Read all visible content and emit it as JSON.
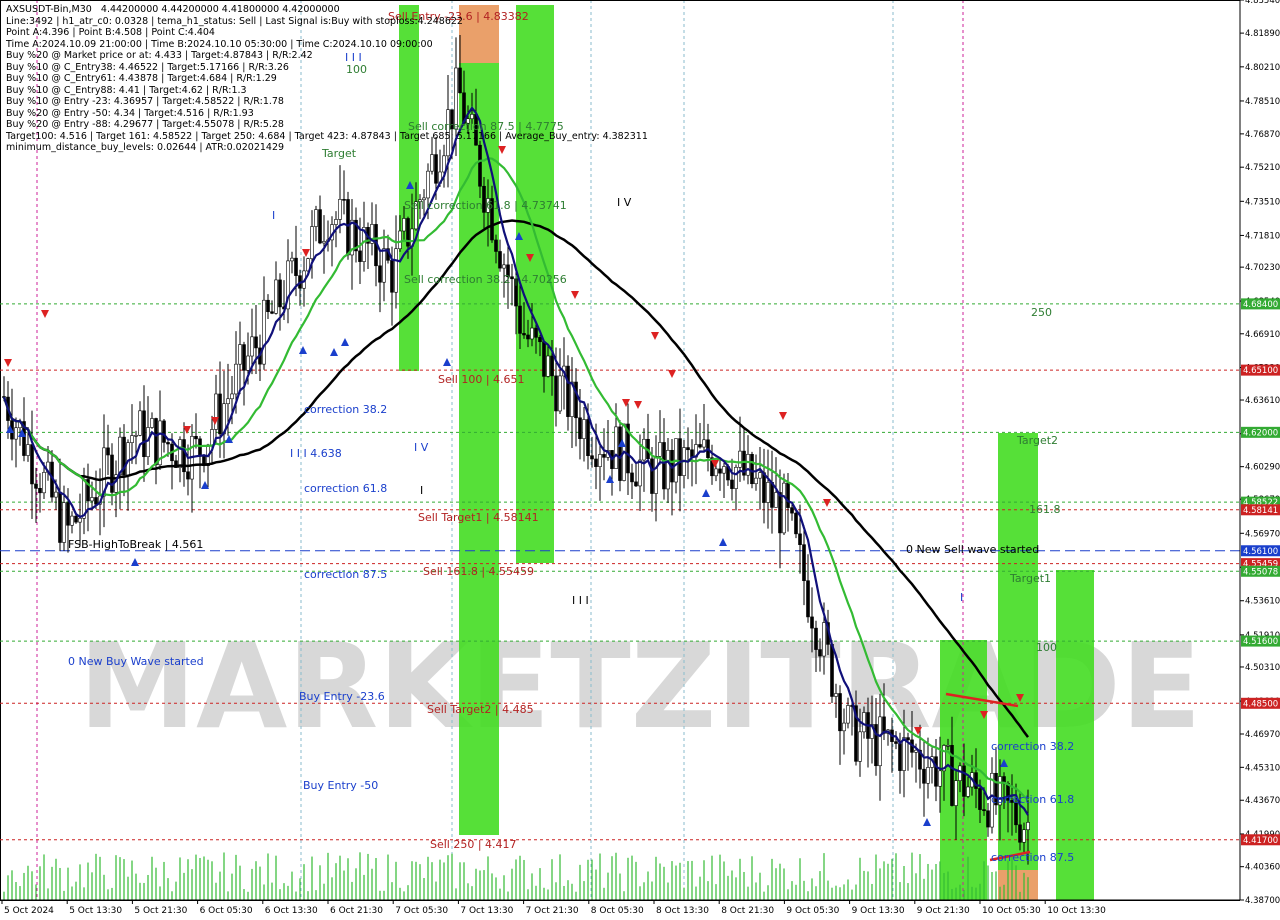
{
  "info_lines": [
    "AXSUSDT-Bin,M30   4.44200000 4.44200000 4.41800000 4.42000000",
    "Line:3492 | h1_atr_c0: 0.0328 | tema_h1_status: Sell | Last Signal is:Buy with stoploss:4.248622",
    "Point A:4.396 | Point B:4.508 | Point C:4.404",
    "Time A:2024.10.09 21:00:00 | Time B:2024.10.10 05:30:00 | Time C:2024.10.10 09:00:00",
    "Buy %20 @ Market price or at: 4.433 | Target:4.87843 | R/R:2.42",
    "Buy %10 @ C_Entry38: 4.46522 | Target:5.17166 | R/R:3.26",
    "Buy %10 @ C_Entry61: 4.43878 | Target:4.684 | R/R:1.29",
    "Buy %10 @ C_Entry88: 4.41 | Target:4.62 | R/R:1.3",
    "Buy %10 @ Entry -23: 4.36957 | Target:4.58522 | R/R:1.78",
    "Buy %20 @ Entry -50: 4.34 | Target:4.516 | R/R:1.93",
    "Buy %20 @ Entry -88: 4.29677 | Target:4.55078 | R/R:5.28",
    "Target100: 4.516 | Target 161: 4.58522 | Target 250: 4.684 | Target 423: 4.87843 | Target 685: 5.17166 | Average_Buy_entry: 4.382311",
    "minimum_distance_buy_levels: 0.02644 | ATR:0.02021429"
  ],
  "watermark": "MARKETZITRADE",
  "price_axis": {
    "ticks": [
      "4.83540",
      "4.81890",
      "4.80210",
      "4.78510",
      "4.76870",
      "4.75210",
      "4.73510",
      "4.71810",
      "4.70230",
      "4.68540",
      "4.66910",
      "4.65230",
      "4.63610",
      "4.61930",
      "4.60290",
      "4.58670",
      "4.56970",
      "4.55280",
      "4.53610",
      "4.51910",
      "4.50310",
      "4.48610",
      "4.46970",
      "4.45310",
      "4.43670",
      "4.41990",
      "4.40360",
      "4.38700"
    ],
    "highlights": [
      {
        "value": "4.68400",
        "color": "#33aa33"
      },
      {
        "value": "4.65100",
        "color": "#cc2222"
      },
      {
        "value": "4.62000",
        "color": "#33aa33"
      },
      {
        "value": "4.58522",
        "color": "#33aa33"
      },
      {
        "value": "4.58141",
        "color": "#cc2222"
      },
      {
        "value": "4.56100",
        "color": "#1a3fcc"
      },
      {
        "value": "4.55459",
        "color": "#cc2222"
      },
      {
        "value": "4.55078",
        "color": "#33aa33"
      },
      {
        "value": "4.51600",
        "color": "#33aa33"
      },
      {
        "value": "4.48500",
        "color": "#cc2222"
      },
      {
        "value": "4.41700",
        "color": "#cc2222"
      }
    ]
  },
  "time_axis": [
    "5 Oct 2024",
    "5 Oct 13:30",
    "5 Oct 21:30",
    "6 Oct 05:30",
    "6 Oct 13:30",
    "6 Oct 21:30",
    "7 Oct 05:30",
    "7 Oct 13:30",
    "7 Oct 21:30",
    "8 Oct 05:30",
    "8 Oct 13:30",
    "8 Oct 21:30",
    "9 Oct 05:30",
    "9 Oct 13:30",
    "9 Oct 21:30",
    "10 Oct 05:30",
    "10 Oct 13:30"
  ],
  "annotations": [
    {
      "text": "Sell Entry -23.6 | 4.83382",
      "color": "#b22222"
    },
    {
      "text": "100",
      "color": "#2e7d32"
    },
    {
      "text": "Target",
      "color": "#2e7d32"
    },
    {
      "text": "Sell correction 87.5 | 4.7775",
      "color": "#2e7d32"
    },
    {
      "text": "Sell correction 61.8 | 4.73741",
      "color": "#2e7d32"
    },
    {
      "text": "Sell correction 38.2 | 4.70256",
      "color": "#2e7d32"
    },
    {
      "text": "I V",
      "color": "#000000"
    },
    {
      "text": "I",
      "color": "#1a3fcc"
    },
    {
      "text": "I I I",
      "color": "#1a3fcc"
    },
    {
      "text": "250",
      "color": "#2e7d32"
    },
    {
      "text": "Sell 100 | 4.651",
      "color": "#b22222"
    },
    {
      "text": "correction 38.2",
      "color": "#1a3fcc"
    },
    {
      "text": "I I I 4.638",
      "color": "#1a3fcc"
    },
    {
      "text": "I V",
      "color": "#1a3fcc"
    },
    {
      "text": "Target2",
      "color": "#2e7d32"
    },
    {
      "text": "correction 61.8",
      "color": "#1a3fcc"
    },
    {
      "text": "I",
      "color": "#000000"
    },
    {
      "text": "Sell Target1 | 4.58141",
      "color": "#b22222"
    },
    {
      "text": "161.8",
      "color": "#2e7d32"
    },
    {
      "text": "FSB-HighToBreak | 4.561",
      "color": "#000000"
    },
    {
      "text": "0 New Sell wave started",
      "color": "#000000"
    },
    {
      "text": "Sell 161.8 | 4.55459",
      "color": "#b22222"
    },
    {
      "text": "correction 87.5",
      "color": "#1a3fcc"
    },
    {
      "text": "Target1",
      "color": "#2e7d32"
    },
    {
      "text": "I I I",
      "color": "#000000"
    },
    {
      "text": "I",
      "color": "#1a3fcc"
    },
    {
      "text": "100",
      "color": "#2e7d32"
    },
    {
      "text": "0 New Buy Wave started",
      "color": "#1a3fcc"
    },
    {
      "text": "Buy Entry -23.6",
      "color": "#1a3fcc"
    },
    {
      "text": "Sell Target2 | 4.485",
      "color": "#b22222"
    },
    {
      "text": "correction 38.2",
      "color": "#1a3fcc"
    },
    {
      "text": "Buy Entry -50",
      "color": "#1a3fcc"
    },
    {
      "text": "correction 61.8",
      "color": "#1a3fcc"
    },
    {
      "text": "Sell  250 | 4.417",
      "color": "#b22222"
    },
    {
      "text": "correction 87.5",
      "color": "#1a3fcc"
    }
  ],
  "colors": {
    "zone_green": "#44dd22",
    "zone_orange": "#e8965a",
    "ema_black": "#000000",
    "ema_green": "#33bb33",
    "ema_navy": "#10107a",
    "sell_red": "#dd2222",
    "buy_blue": "#1a3fcc",
    "candle": "#000000"
  },
  "chart_data": {
    "type": "candlestick",
    "symbol": "AXSUSDT-Bin",
    "timeframe": "M30",
    "ylim": [
      4.387,
      4.8354
    ],
    "key_levels": [
      4.684,
      4.651,
      4.62,
      4.58522,
      4.58141,
      4.561,
      4.55459,
      4.55078,
      4.516,
      4.485,
      4.417
    ],
    "close_path": [
      {
        "t": "5 Oct 2024",
        "price": 4.64
      },
      {
        "t": "5 Oct 13:30",
        "price": 4.57
      },
      {
        "t": "5 Oct 21:30",
        "price": 4.62
      },
      {
        "t": "6 Oct 05:30",
        "price": 4.61
      },
      {
        "t": "6 Oct 13:30",
        "price": 4.67
      },
      {
        "t": "6 Oct 21:30",
        "price": 4.73
      },
      {
        "t": "7 Oct 05:30",
        "price": 4.7
      },
      {
        "t": "7 Oct 13:30",
        "price": 4.79
      },
      {
        "t": "7 Oct 21:30",
        "price": 4.67
      },
      {
        "t": "8 Oct 05:30",
        "price": 4.62
      },
      {
        "t": "8 Oct 13:30",
        "price": 4.6
      },
      {
        "t": "8 Oct 21:30",
        "price": 4.61
      },
      {
        "t": "9 Oct 05:30",
        "price": 4.58
      },
      {
        "t": "9 Oct 13:30",
        "price": 4.47
      },
      {
        "t": "9 Oct 21:30",
        "price": 4.46
      },
      {
        "t": "10 Oct 05:30",
        "price": 4.44
      },
      {
        "t": "10 Oct 13:30",
        "price": 4.42
      }
    ]
  }
}
